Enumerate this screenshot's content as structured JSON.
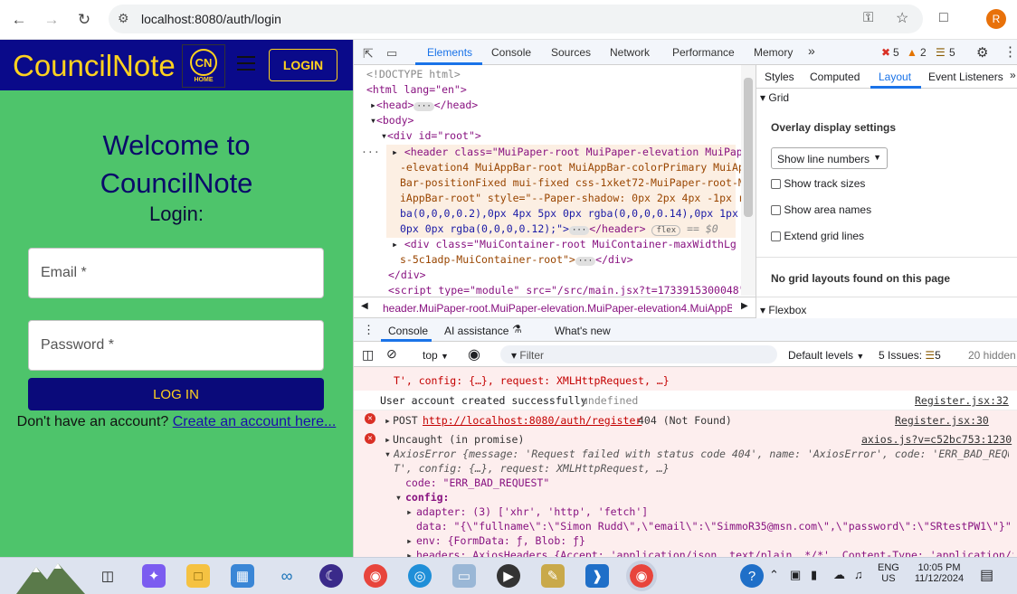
{
  "browser": {
    "url": "localhost:8080/auth/login",
    "profile_initial": "R"
  },
  "app": {
    "brand": "CouncilNote",
    "logo_text": "CN",
    "logo_sub": "HOME",
    "login_button": "LOGIN",
    "welcome_line1": "Welcome to",
    "welcome_line2": "CouncilNote",
    "login_heading": "Login:",
    "email_label": "Email *",
    "password_label": "Password *",
    "submit": "LOG IN",
    "no_account": "Don't have an account?",
    "create_link": "Create an account here..."
  },
  "devtools": {
    "tabs": [
      "Elements",
      "Console",
      "Sources",
      "Network",
      "Performance",
      "Memory"
    ],
    "error_count": "5",
    "warning_count": "2",
    "info_count": "5",
    "elements": {
      "doctype": "<!DOCTYPE html>",
      "html_open": "<html lang=\"en\">",
      "head": "<head>",
      "head_close": "</head>",
      "body_open": "<body>",
      "div_root": "<div id=\"root\">",
      "header_l1": "<header class=\"MuiPaper-root MuiPaper-elevation MuiPaper",
      "header_l2": "-elevation4 MuiAppBar-root MuiAppBar-colorPrimary MuiApp",
      "header_l3": "Bar-positionFixed mui-fixed css-1xket72-MuiPaper-root-Mu",
      "header_l4": "iAppBar-root\" style=\"--Paper-shadow: 0px 2px 4px -1px rg",
      "header_l5": "ba(0,0,0,0.2),0px 4px 5px 0px rgba(0,0,0,0.14),0px 1px 1",
      "header_l6": "0px 0px rgba(0,0,0,0.12);\">",
      "header_close": "</header>",
      "flex_badge": "flex",
      "dollar0": "== $0",
      "container_l1": "<div class=\"MuiContainer-root MuiContainer-maxWidthLg cs",
      "container_l2": "s-5c1adp-MuiContainer-root\">",
      "div_close": "</div>",
      "div_close2": "</div>",
      "script": "<script type=\"module\" src=\"/src/main.jsx?t=1733915300048\">",
      "breadcrumb": "header.MuiPaper-root.MuiPaper-elevation.MuiPaper-elevation4.MuiAppB"
    },
    "styles_tabs": [
      "Styles",
      "Computed",
      "Layout",
      "Event Listeners"
    ],
    "layout": {
      "grid_section": "Grid",
      "overlay_title": "Overlay display settings",
      "show_line_numbers": "Show line numbers",
      "options": [
        "Show track sizes",
        "Show area names",
        "Extend grid lines"
      ],
      "no_grid": "No grid layouts found on this page",
      "flexbox_section": "Flexbox"
    },
    "drawer_tabs": [
      "Console",
      "AI assistance",
      "What's new"
    ],
    "console_toolbar": {
      "context": "top",
      "filter": "Filter",
      "levels": "Default levels",
      "issues": "5 Issues:",
      "issues_count": "5",
      "hidden": "20 hidden"
    },
    "console": {
      "line_partial": "T', config: {…}, request: XMLHttpRequest, …}",
      "log1": "User account created successfully",
      "log1_undefined": "undefined",
      "log1_src": "Register.jsx:32",
      "err1_method": "POST",
      "err1_url": "http://localhost:8080/auth/register",
      "err1_status": "404 (Not Found)",
      "err1_src": "Register.jsx:30",
      "err2": "Uncaught (in promise)",
      "err2_src": "axios.js?v=c52bc753:1230",
      "axios_l1": "AxiosError {message: 'Request failed with status code 404', name: 'AxiosError', code: 'ERR_BAD_REQUES",
      "axios_l2": "T', config: {…}, request: XMLHttpRequest, …}",
      "code": "code: \"ERR_BAD_REQUEST\"",
      "config": "config:",
      "adapter": "adapter: (3) ['xhr', 'http', 'fetch']",
      "data": "data: \"{\\\"fullname\\\":\\\"Simon Rudd\\\",\\\"email\\\":\\\"SimmoR35@msn.com\\\",\\\"password\\\":\\\"SRtestPW1\\\"}\"",
      "env": "env: {FormData: ƒ, Blob: ƒ}",
      "headers": "headers: AxiosHeaders {Accept: 'application/json, text/plain, */*', Content-Type: 'application/json'"
    }
  },
  "taskbar": {
    "lang1": "ENG",
    "lang2": "US",
    "time": "10:05 PM",
    "date": "11/12/2024"
  }
}
